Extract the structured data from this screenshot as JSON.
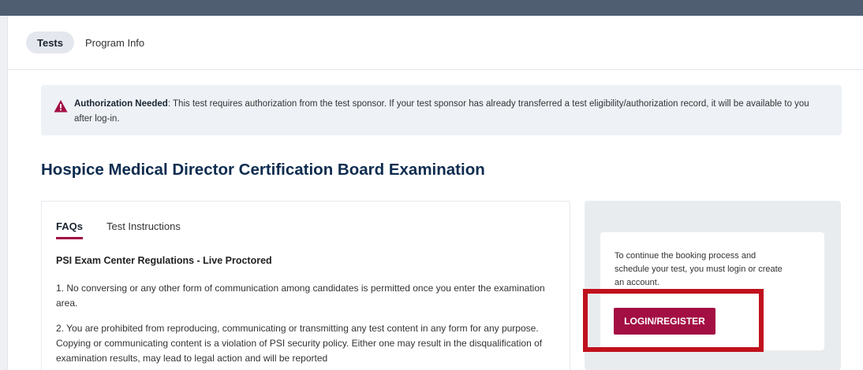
{
  "top_tabs": [
    {
      "label": "Tests",
      "active": true
    },
    {
      "label": "Program Info",
      "active": false
    }
  ],
  "alert": {
    "title": "Authorization Needed",
    "message": ": This test requires authorization from the test sponsor. If your test sponsor has already transferred a test eligibility/authorization record, it will be available to you after log-in.",
    "icon": "warning-icon"
  },
  "page_title": "Hospice Medical Director Certification Board Examination",
  "content_tabs": [
    {
      "label": "FAQs",
      "active": true
    },
    {
      "label": "Test Instructions",
      "active": false
    }
  ],
  "regulations": {
    "heading": "PSI Exam Center Regulations - Live Proctored",
    "items": [
      "1. No conversing or any other form of communication among candidates is permitted once you enter the examination area.",
      "2. You are prohibited from reproducing, communicating or transmitting any test content in any form for any purpose. Copying or communicating content is a violation of PSI security policy. Either one may result in the disqualification of examination results, may lead to legal action and will be reported"
    ]
  },
  "booking": {
    "message": "To continue the booking process and schedule your test, you must login or create an account.",
    "button_label": "LOGIN/REGISTER"
  },
  "colors": {
    "header_bar": "#4f5e70",
    "accent": "#a30e43",
    "title": "#0e2c4f",
    "highlight": "#c0111d"
  }
}
